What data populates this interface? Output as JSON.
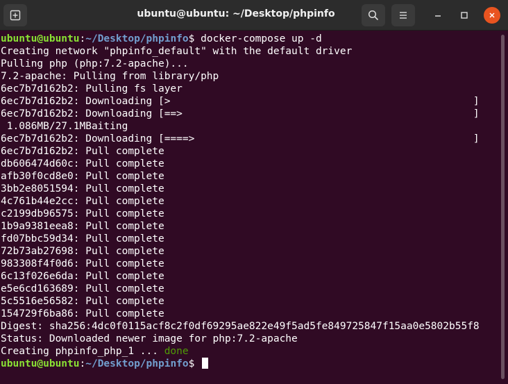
{
  "window": {
    "title": "ubuntu@ubuntu: ~/Desktop/phpinfo",
    "icons": {
      "new_tab": "new-tab-icon",
      "search": "search-icon",
      "menu": "hamburger-menu-icon",
      "minimize": "minimize-icon",
      "maximize": "maximize-icon",
      "close": "close-icon"
    },
    "close_color": "#e95420"
  },
  "prompt": {
    "user_host": "ubuntu@ubuntu",
    "sep": ":",
    "path": "~/Desktop/phpinfo",
    "symbol": "$ "
  },
  "colors": {
    "background": "#300a24",
    "prompt_user": "#8ae234",
    "prompt_path": "#729fcf",
    "done": "#4e9a06"
  },
  "terminal": {
    "command": "docker-compose up -d",
    "lines": [
      "Creating network \"phpinfo_default\" with the default driver",
      "Pulling php (php:7.2-apache)...",
      "7.2-apache: Pulling from library/php",
      "6ec7b7d162b2: Pulling fs layer",
      "6ec7b7d162b2: Downloading [>                                                  ]",
      "6ec7b7d162b2: Downloading [==>                                                ]",
      " 1.086MB/27.1MBaiting",
      "6ec7b7d162b2: Downloading [====>                                              ]",
      "6ec7b7d162b2: Pull complete",
      "db606474d60c: Pull complete",
      "afb30f0cd8e0: Pull complete",
      "3bb2e8051594: Pull complete",
      "4c761b44e2cc: Pull complete",
      "c2199db96575: Pull complete",
      "1b9a9381eea8: Pull complete",
      "fd07bbc59d34: Pull complete",
      "72b73ab27698: Pull complete",
      "983308f4f0d6: Pull complete",
      "6c13f026e6da: Pull complete",
      "e5e6cd163689: Pull complete",
      "5c5516e56582: Pull complete",
      "154729f6ba86: Pull complete",
      "Digest: sha256:4dc0f0115acf8c2f0df69295ae822e49f5ad5fe849725847f15aa0e5802b55f8",
      "Status: Downloaded newer image for php:7.2-apache"
    ],
    "creating_prefix": "Creating phpinfo_php_1 ... ",
    "creating_status": "done"
  }
}
